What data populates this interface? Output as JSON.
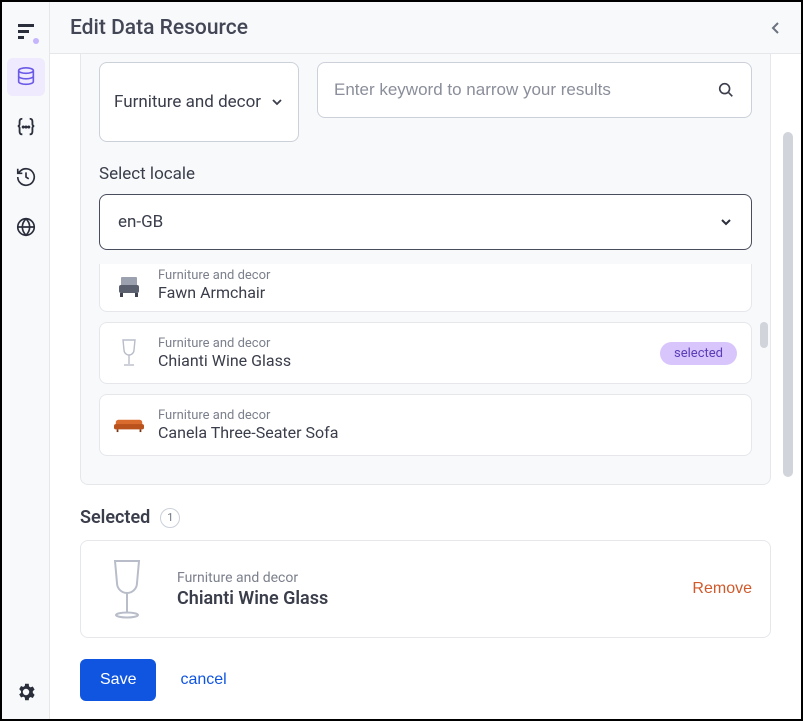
{
  "header": {
    "title": "Edit Data Resource"
  },
  "filter": {
    "category": "Furniture and decor",
    "search_placeholder": "Enter keyword to narrow your results",
    "locale_label": "Select locale",
    "locale_value": "en-GB"
  },
  "badges": {
    "selected_label": "selected"
  },
  "results": [
    {
      "category": "Furniture and decor",
      "name": "Fawn Armchair",
      "icon": "armchair",
      "selected": false,
      "truncated": true
    },
    {
      "category": "Furniture and decor",
      "name": "Chianti Wine Glass",
      "icon": "wine-glass",
      "selected": true
    },
    {
      "category": "Furniture and decor",
      "name": "Canela Three-Seater Sofa",
      "icon": "sofa",
      "selected": false
    }
  ],
  "selected": {
    "heading": "Selected",
    "count": "1",
    "items": [
      {
        "category": "Furniture and decor",
        "name": "Chianti Wine Glass",
        "icon": "wine-glass"
      }
    ],
    "remove_label": "Remove"
  },
  "footer": {
    "save_label": "Save",
    "cancel_label": "cancel"
  }
}
